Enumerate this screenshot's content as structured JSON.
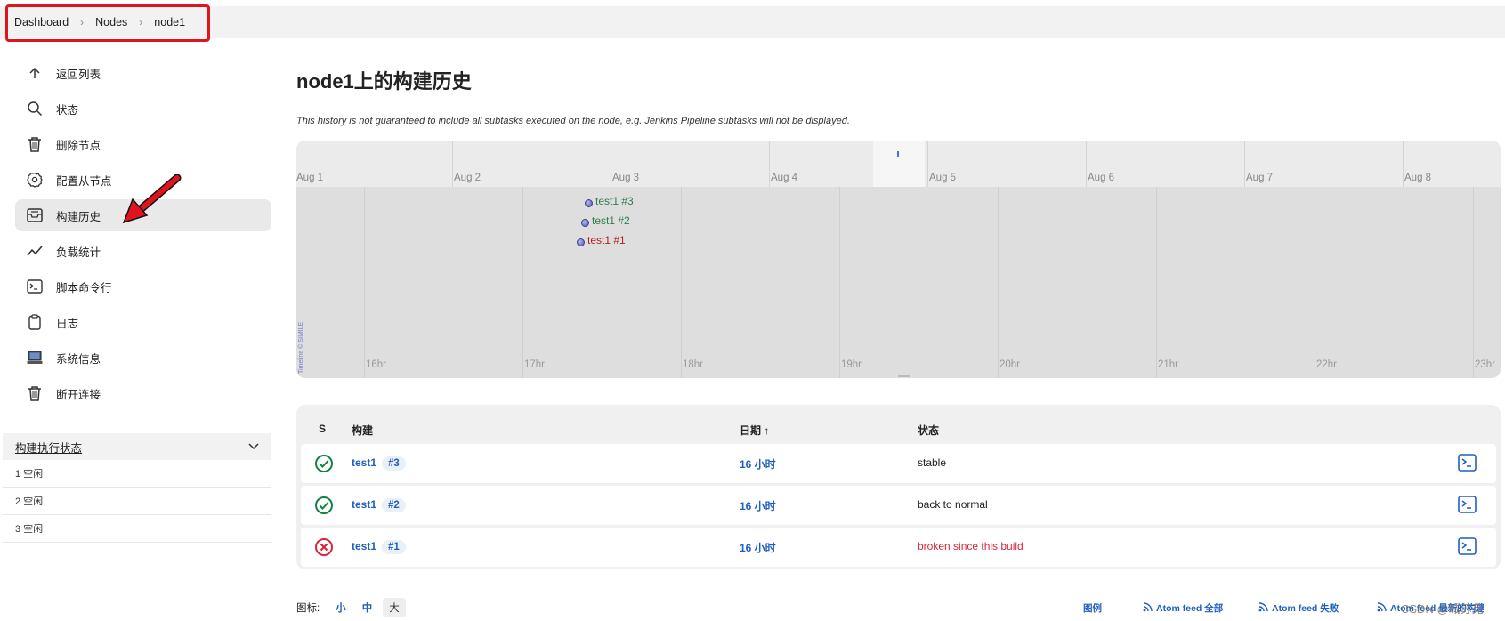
{
  "breadcrumb": [
    "Dashboard",
    "Nodes",
    "node1"
  ],
  "sidebar": {
    "items": [
      {
        "label": "返回列表",
        "icon": "arrow-up-icon"
      },
      {
        "label": "状态",
        "icon": "search-icon"
      },
      {
        "label": "删除节点",
        "icon": "trash-icon"
      },
      {
        "label": "配置从节点",
        "icon": "gear-icon"
      },
      {
        "label": "构建历史",
        "icon": "inbox-icon",
        "active": true
      },
      {
        "label": "负载统计",
        "icon": "trend-line-icon"
      },
      {
        "label": "脚本命令行",
        "icon": "terminal-icon"
      },
      {
        "label": "日志",
        "icon": "clipboard-icon"
      },
      {
        "label": "系统信息",
        "icon": "computer-icon"
      },
      {
        "label": "断开连接",
        "icon": "trash-icon"
      }
    ]
  },
  "executors": {
    "title": "构建执行状态",
    "rows": [
      "1  空闲",
      "2  空闲",
      "3  空闲"
    ]
  },
  "main": {
    "title": "node1上的构建历史",
    "note": "This history is not guaranteed to include all subtasks executed on the node, e.g. Jenkins Pipeline subtasks will not be displayed."
  },
  "timeline": {
    "days": [
      "Aug 1",
      "Aug 2",
      "Aug 3",
      "Aug 4",
      "Aug 5",
      "Aug 6",
      "Aug 7",
      "Aug 8"
    ],
    "hours": [
      "16hr",
      "17hr",
      "18hr",
      "19hr",
      "20hr",
      "21hr",
      "22hr",
      "23hr"
    ],
    "events": [
      {
        "label": "test1 #3",
        "color": "#2e7d4f"
      },
      {
        "label": "test1 #2",
        "color": "#2e7d4f"
      },
      {
        "label": "test1 #1",
        "color": "#b22222"
      }
    ],
    "credit": "Timeline © SIMILE"
  },
  "table": {
    "headers": {
      "s": "S",
      "build": "构建",
      "date": "日期 ↑",
      "status": "状态"
    },
    "rows": [
      {
        "result": "success",
        "job": "test1",
        "build": "#3",
        "date": "16 小时",
        "status": "stable",
        "status_color": "#1e1e1e"
      },
      {
        "result": "success",
        "job": "test1",
        "build": "#2",
        "date": "16 小时",
        "status": "back to normal",
        "status_color": "#1e1e1e"
      },
      {
        "result": "failure",
        "job": "test1",
        "build": "#1",
        "date": "16 小时",
        "status": "broken since this build",
        "status_color": "#d6283a"
      }
    ]
  },
  "footer": {
    "icon_label": "图标:",
    "sizes": [
      "小",
      "中",
      "大"
    ],
    "legend": "图例",
    "feed_all": "Atom feed 全部",
    "feed_failed": "Atom feed 失败",
    "feed_latest": "Atom feed 最新的构建",
    "watermark": "CSDN @城苏苑"
  },
  "colors": {
    "accent": "#1f5fbf",
    "success": "#138347",
    "failure": "#d6283a",
    "highlight": "#e0141c"
  }
}
